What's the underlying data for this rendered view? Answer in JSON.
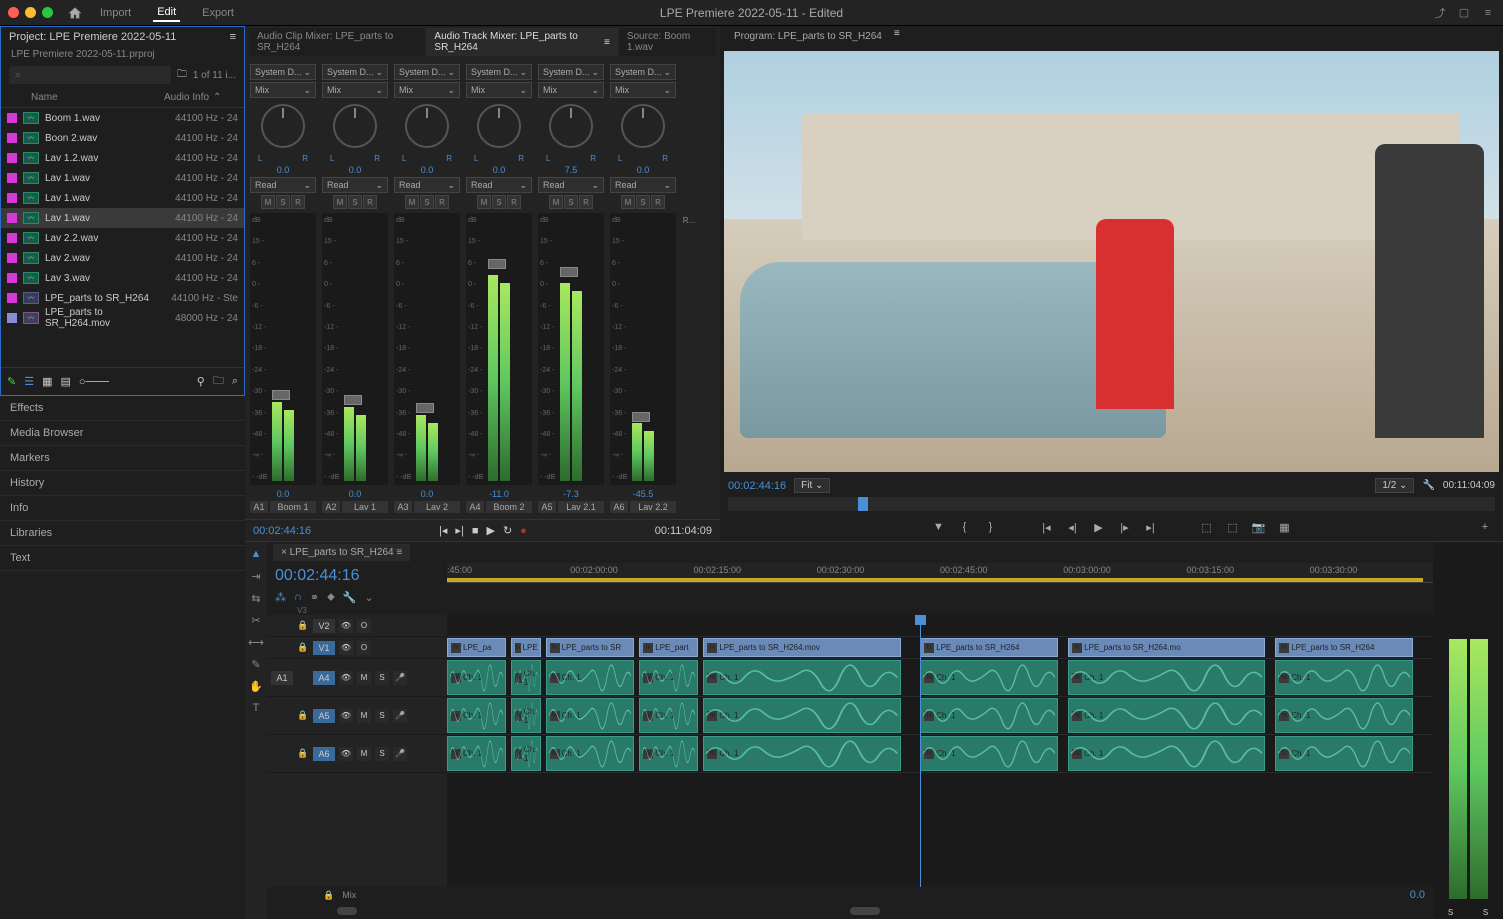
{
  "top": {
    "tabs": [
      "Import",
      "Edit",
      "Export"
    ],
    "active": "Edit",
    "title": "LPE Premiere 2022-05-11 - Edited"
  },
  "project": {
    "panel_title": "Project: LPE Premiere 2022-05-11",
    "file": "LPE Premiere 2022-05-11.prproj",
    "search_placeholder": "⌕",
    "count": "1 of 11 i...",
    "col_name": "Name",
    "col_info": "Audio Info",
    "items": [
      {
        "color": "#d838d8",
        "icon": "aud",
        "name": "Boom 1.wav",
        "info": "44100 Hz - 24"
      },
      {
        "color": "#d838d8",
        "icon": "aud",
        "name": "Boon 2.wav",
        "info": "44100 Hz - 24"
      },
      {
        "color": "#d838d8",
        "icon": "aud",
        "name": "Lav 1.2.wav",
        "info": "44100 Hz - 24"
      },
      {
        "color": "#d838d8",
        "icon": "aud",
        "name": "Lav 1.wav",
        "info": "44100 Hz - 24"
      },
      {
        "color": "#d838d8",
        "icon": "aud",
        "name": "Lav 1.wav",
        "info": "44100 Hz - 24"
      },
      {
        "color": "#d838d8",
        "icon": "aud",
        "name": "Lav 1.wav",
        "info": "44100 Hz - 24",
        "sel": true
      },
      {
        "color": "#d838d8",
        "icon": "aud",
        "name": "Lav 2.2.wav",
        "info": "44100 Hz - 24"
      },
      {
        "color": "#d838d8",
        "icon": "aud",
        "name": "Lav 2.wav",
        "info": "44100 Hz - 24"
      },
      {
        "color": "#d838d8",
        "icon": "aud",
        "name": "Lav 3.wav",
        "info": "44100 Hz - 24"
      },
      {
        "color": "#d838d8",
        "icon": "seq",
        "name": "LPE_parts to SR_H264",
        "info": "44100 Hz - Ste"
      },
      {
        "color": "#8a8ad8",
        "icon": "mov",
        "name": "LPE_parts to SR_H264.mov",
        "info": "48000 Hz - 24"
      }
    ]
  },
  "left_panels": [
    "Effects",
    "Media Browser",
    "Markers",
    "History",
    "Info",
    "Libraries",
    "Text"
  ],
  "mixer": {
    "tabs": [
      {
        "label": "Audio Clip Mixer: LPE_parts to SR_H264"
      },
      {
        "label": "Audio Track Mixer: LPE_parts to SR_H264",
        "active": true
      },
      {
        "label": "Source: Boom 1.wav"
      }
    ],
    "dd1": "System D...",
    "dd2": "Mix",
    "read": "Read",
    "knob0": "0.0",
    "channels": [
      {
        "a": "A1",
        "name": "Boom 1",
        "db": "0.0",
        "pan": "0.0",
        "level": 30
      },
      {
        "a": "A2",
        "name": "Lav 1",
        "db": "0.0",
        "pan": "0.0",
        "level": 28
      },
      {
        "a": "A3",
        "name": "Lav 2",
        "db": "0.0",
        "pan": "0.0",
        "level": 25
      },
      {
        "a": "A4",
        "name": "Boom 2",
        "db": "-11.0",
        "pan": "0.0",
        "level": 78
      },
      {
        "a": "A5",
        "name": "Lav 2.1",
        "db": "-7.3",
        "pan": "7.5",
        "level": 75
      },
      {
        "a": "A6",
        "name": "Lav 2.2",
        "db": "-45.5",
        "pan": "0.0",
        "level": 22
      }
    ],
    "scale": [
      "dB",
      "15 -",
      "6 -",
      "0 -",
      "-6 -",
      "-12 -",
      "-18 -",
      "-24 -",
      "-30 -",
      "-36 -",
      "-48 -",
      "-∞ -",
      "- -dB"
    ],
    "tc_in": "00:02:44:16",
    "tc_out": "00:11:04:09"
  },
  "program": {
    "tab": "Program: LPE_parts to SR_H264",
    "tc_in": "00:02:44:16",
    "fit": "Fit",
    "half": "1/2",
    "tc_out": "00:11:04:09"
  },
  "timeline": {
    "tab": "LPE_parts to SR_H264",
    "tc": "00:02:44:16",
    "vs": "V3",
    "ruler": [
      ":45:00",
      "00:02:00:00",
      "00:02:15:00",
      "00:02:30:00",
      "00:02:45:00",
      "00:03:00:00",
      "00:03:15:00",
      "00:03:30:00"
    ],
    "tracks": {
      "v2": "V2",
      "v1": "V1",
      "a4": "A4",
      "a5": "A5",
      "a6": "A6",
      "mix": "Mix",
      "a1": "A1"
    },
    "btns": {
      "m": "M",
      "s": "S",
      "o": "O",
      "r": "R"
    },
    "clips": [
      {
        "l": 0,
        "w": 6,
        "label": "LPE_pa"
      },
      {
        "l": 6.5,
        "w": 3,
        "label": "LPE"
      },
      {
        "l": 10,
        "w": 9,
        "label": "LPE_parts to SR"
      },
      {
        "l": 19.5,
        "w": 6,
        "label": "LPE_part"
      },
      {
        "l": 26,
        "w": 20,
        "label": "LPE_parts to SR_H264.mov"
      },
      {
        "l": 48,
        "w": 14,
        "label": "LPE_parts to SR_H264"
      },
      {
        "l": 63,
        "w": 20,
        "label": "LPE_parts to SR_H264.mo"
      },
      {
        "l": 84,
        "w": 14,
        "label": "LPE_parts to SR_H264"
      }
    ],
    "ch": "Ch. 1",
    "mix0": "0.0"
  }
}
